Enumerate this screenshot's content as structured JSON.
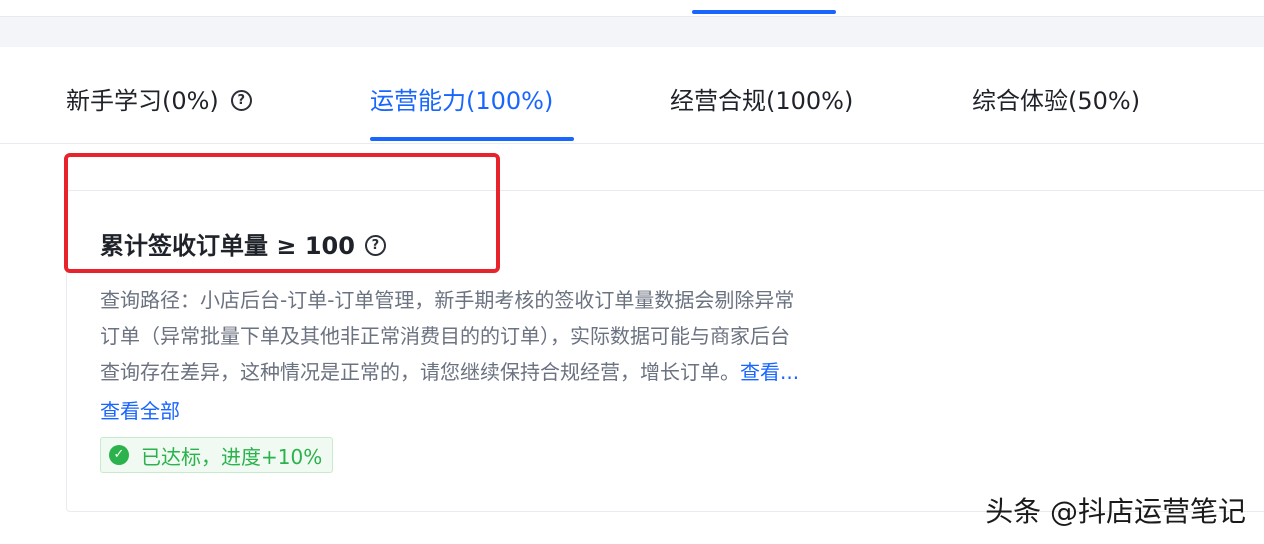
{
  "tabs": [
    {
      "label": "新手学习(0%)",
      "active": false,
      "has_help": true
    },
    {
      "label": "运营能力(100%)",
      "active": true,
      "has_help": false
    },
    {
      "label": "经营合规(100%)",
      "active": false,
      "has_help": false
    },
    {
      "label": "综合体验(50%)",
      "active": false,
      "has_help": false
    }
  ],
  "card": {
    "title": "累计签收订单量 ≥ 100",
    "description_lines": [
      "查询路径：小店后台-订单-订单管理，新手期考核的签收订单量数据会剔除异常",
      "订单（异常批量下单及其他非正常消费目的的订单），实际数据可能与商家后台",
      "查询存在差异，这种情况是正常的，请您继续保持合规经营，增长订单。"
    ],
    "inline_link": "查看...",
    "view_all": "查看全部",
    "status": "已达标，进度+10%"
  },
  "icons": {
    "help": "question-circle-icon",
    "status": "check-circle-icon"
  },
  "colors": {
    "accent": "#1966ff",
    "success": "#2bb24c",
    "highlight_box": "#e8232b"
  },
  "watermark": "头条 @抖店运营笔记"
}
